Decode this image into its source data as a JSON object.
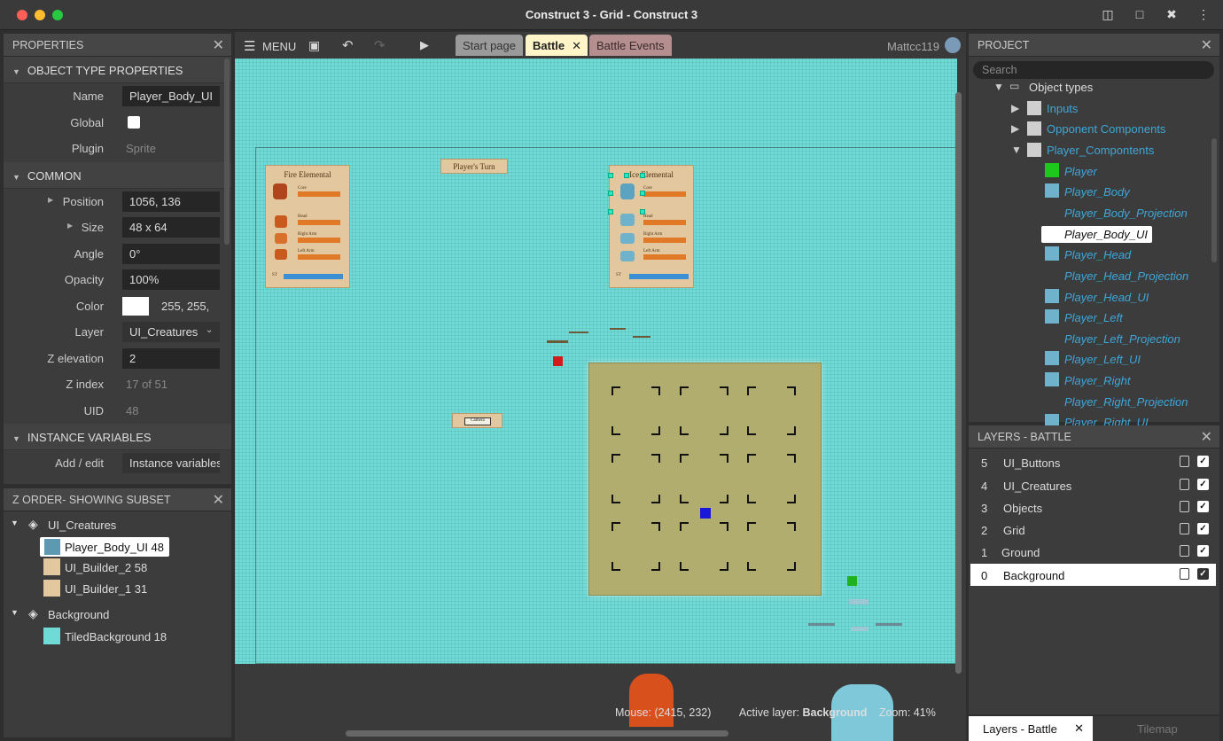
{
  "window": {
    "title": "Construct 3 - Grid - Construct 3"
  },
  "toolbar": {
    "menu_label": "MENU",
    "user": "Mattcc119"
  },
  "tabs": [
    {
      "label": "Start page"
    },
    {
      "label": "Battle"
    },
    {
      "label": "Battle Events"
    }
  ],
  "properties": {
    "header": "PROPERTIES",
    "object_type_section": "OBJECT TYPE PROPERTIES",
    "name_label": "Name",
    "name_value": "Player_Body_UI",
    "global_label": "Global",
    "plugin_label": "Plugin",
    "plugin_value": "Sprite",
    "common_section": "COMMON",
    "position_label": "Position",
    "position_value": "1056, 136",
    "size_label": "Size",
    "size_value": "48 x 64",
    "angle_label": "Angle",
    "angle_value": "0°",
    "opacity_label": "Opacity",
    "opacity_value": "100%",
    "color_label": "Color",
    "color_value": "255, 255,",
    "layer_label": "Layer",
    "layer_value": "UI_Creatures",
    "zelev_label": "Z elevation",
    "zelev_value": "2",
    "zindex_label": "Z index",
    "zindex_value": "17 of 51",
    "uid_label": "UID",
    "uid_value": "48",
    "instvars_section": "INSTANCE VARIABLES",
    "addedit_label": "Add / edit",
    "addedit_value": "Instance variables"
  },
  "zorder": {
    "header": "Z ORDER- SHOWING SUBSET",
    "groups": [
      {
        "name": "UI_Creatures",
        "items": [
          "Player_Body_UI 48",
          "UI_Builder_2 58",
          "UI_Builder_1 31"
        ]
      },
      {
        "name": "Background",
        "items": [
          "TiledBackground 18"
        ]
      }
    ]
  },
  "project": {
    "header": "PROJECT",
    "search_placeholder": "Search",
    "object_types": "Object types",
    "folders": [
      "Inputs",
      "Opponent Components",
      "Player_Compontents"
    ],
    "items": [
      "Player",
      "Player_Body",
      "Player_Body_Projection",
      "Player_Body_UI",
      "Player_Head",
      "Player_Head_Projection",
      "Player_Head_UI",
      "Player_Left",
      "Player_Left_Projection",
      "Player_Left_UI",
      "Player_Right",
      "Player_Right_Projection",
      "Player_Right_UI"
    ]
  },
  "layers": {
    "header": "LAYERS - BATTLE",
    "rows": [
      {
        "index": "5",
        "name": "UI_Buttons"
      },
      {
        "index": "4",
        "name": "UI_Creatures"
      },
      {
        "index": "3",
        "name": "Objects"
      },
      {
        "index": "2",
        "name": "Grid"
      },
      {
        "index": "1",
        "name": "Ground"
      },
      {
        "index": "0",
        "name": "Background"
      }
    ],
    "bottom_tabs": [
      "Layers - Battle",
      "Tilemap"
    ]
  },
  "layout": {
    "fire_title": "Fire Elemental",
    "ice_title": "Ice Elemental",
    "turn_label": "Player's Turn",
    "core": "Core",
    "head": "Head",
    "right_arm": "Right Arm",
    "left_arm": "Left Arm",
    "st": "ST",
    "camera": "Camera"
  },
  "status": {
    "mouse": "Mouse: (2415, 232)",
    "active_layer_label": "Active layer:",
    "active_layer": "Background",
    "zoom": "Zoom: 41%"
  },
  "colors": {
    "canvas_bg": "#6fdad6",
    "accent_link": "#3ea6d8",
    "grid_tile": "#b1ad6f"
  }
}
